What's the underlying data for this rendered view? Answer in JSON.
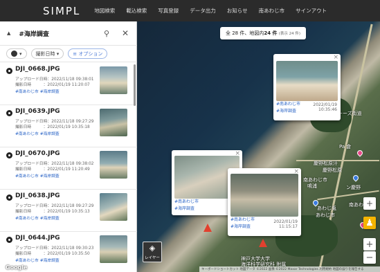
{
  "header": {
    "logo": "SIMPL",
    "nav": [
      "地図検索",
      "載込検索",
      "写真登録",
      "データ出力",
      "お知らせ",
      "南あわじ市",
      "サインアウト"
    ]
  },
  "search": {
    "query": "#海岸調査"
  },
  "filters": {
    "sort": "撮影日時",
    "option": "オプション"
  },
  "list": [
    {
      "name": "DJI_0668.JPG",
      "upload_label": "アップロード日時",
      "upload": "2022/11/18 09:38:01",
      "shot_label": "撮影日時",
      "shot": "2022/01/19 11:20:07",
      "tag1": "#南あわじ市",
      "tag2": "#海岸調査"
    },
    {
      "name": "DJI_0639.JPG",
      "upload_label": "アップロード日時",
      "upload": "2022/11/18 09:27:29",
      "shot_label": "撮影日時",
      "shot": "2022/01/19 10:35:18",
      "tag1": "#南あわじ市",
      "tag2": "#海岸調査"
    },
    {
      "name": "DJI_0670.JPG",
      "upload_label": "アップロード日時",
      "upload": "2022/11/18 09:38:02",
      "shot_label": "撮影日時",
      "shot": "2022/01/19 11:20:49",
      "tag1": "#南あわじ市",
      "tag2": "#海岸調査"
    },
    {
      "name": "DJI_0638.JPG",
      "upload_label": "アップロード日時",
      "upload": "2022/11/18 09:27:29",
      "shot_label": "撮影日時",
      "shot": "2022/01/19 10:35:13",
      "tag1": "#南あわじ市",
      "tag2": "#海岸調査"
    },
    {
      "name": "DJI_0644.JPG",
      "upload_label": "アップロード日時",
      "upload": "2022/11/18 09:30:23",
      "shot_label": "撮影日時",
      "shot": "2022/01/19 10:35:50",
      "tag1": "#南あわじ市",
      "tag2": "#海岸調査"
    }
  ],
  "map": {
    "count_prefix": "全 28 件、地図内",
    "count_bold": "24 件",
    "count_suffix": "(表示 24 件)",
    "labels": [
      "ーーズ街道",
      "慶野松原汗",
      "慶野松原",
      "南あわじ市",
      "鳴浦",
      "あわじ市",
      "あわじ兎",
      "南あわじ市",
      "ン慶野",
      "Pa 倉",
      "神戸大学大学",
      "海洋科学研究科 附属"
    ],
    "popups": [
      {
        "tag1": "#南あわじ市",
        "tag2": "#海岸調査",
        "date": "2022/01/19",
        "time": "10:35:46"
      },
      {
        "tag1": "#南あわじ市",
        "tag2": "#海岸調査"
      },
      {
        "tag1": "#南あわじ市",
        "tag2": "#海岸調査",
        "date": "2022/01/19",
        "time": "11:15:17"
      }
    ],
    "layer_label": "レイヤー",
    "attribution": "キーボードショートカット  地図データ ©2022 画像 ©2022 Maxar Technologies 利用規約  地図の誤りを報告する",
    "google": "Google",
    "colors": {
      "pin": "#e84a8a",
      "arrow": "#e2402e",
      "tag": "#2a64c6"
    }
  }
}
